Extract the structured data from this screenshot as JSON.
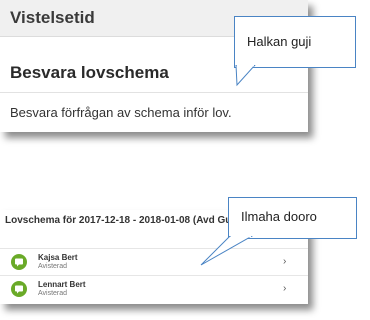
{
  "section": {
    "title": "Vistelsetid",
    "item_title": "Besvara lovschema",
    "item_description": "Besvara förfrågan av schema inför lov."
  },
  "callouts": {
    "first": "Halkan guji",
    "second": "Ilmaha dooro"
  },
  "schedule_list": {
    "header": "Lovschema för 2017-12-18 - 2018-01-08 (Avd Gul)",
    "rows": [
      {
        "name": "Kajsa Bert",
        "status": "Avisterad"
      },
      {
        "name": "Lennart Bert",
        "status": "Avisterad"
      }
    ]
  },
  "colors": {
    "avatar": "#6aaa28",
    "callout_border": "#4a84c4"
  }
}
